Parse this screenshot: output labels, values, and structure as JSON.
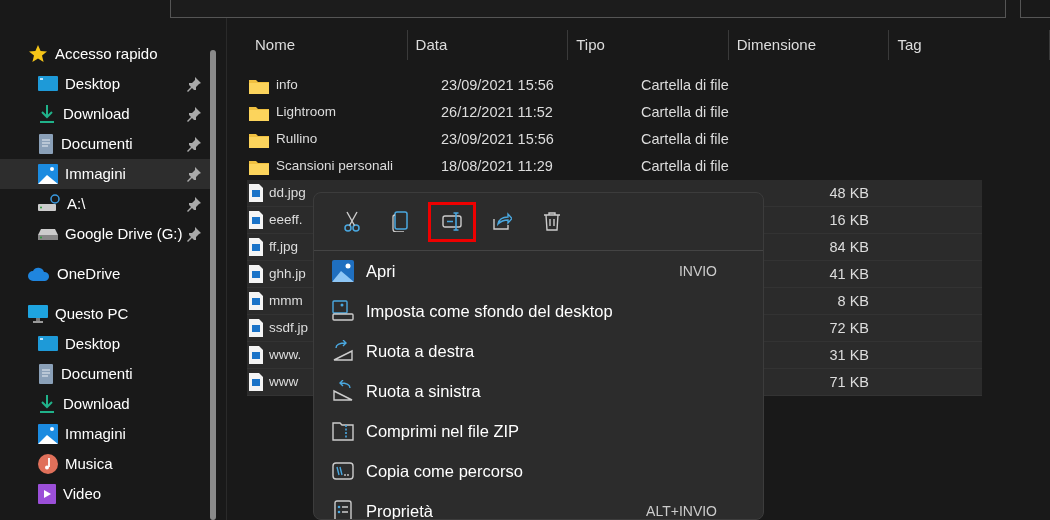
{
  "sidebar": {
    "items": [
      {
        "label": "Accesso rapido",
        "kind": "star",
        "children": [
          {
            "label": "Desktop",
            "kind": "desktop",
            "pinned": true,
            "selected": false
          },
          {
            "label": "Download",
            "kind": "download",
            "pinned": true,
            "selected": false
          },
          {
            "label": "Documenti",
            "kind": "document",
            "pinned": true,
            "selected": false
          },
          {
            "label": "Immagini",
            "kind": "pictures",
            "pinned": true,
            "selected": true
          },
          {
            "label": "A:\\",
            "kind": "netdrive",
            "pinned": true,
            "selected": false
          },
          {
            "label": "Google Drive (G:)",
            "kind": "drive",
            "pinned": true,
            "selected": false
          }
        ]
      },
      {
        "label": "OneDrive",
        "kind": "cloud"
      },
      {
        "label": "Questo PC",
        "kind": "pc",
        "children": [
          {
            "label": "Desktop",
            "kind": "desktop",
            "pinned": false,
            "selected": false
          },
          {
            "label": "Documenti",
            "kind": "document",
            "pinned": false,
            "selected": false
          },
          {
            "label": "Download",
            "kind": "download",
            "pinned": false,
            "selected": false
          },
          {
            "label": "Immagini",
            "kind": "pictures",
            "pinned": false,
            "selected": false
          },
          {
            "label": "Musica",
            "kind": "music",
            "pinned": false,
            "selected": false
          },
          {
            "label": "Video",
            "kind": "video",
            "pinned": false,
            "selected": false
          }
        ]
      }
    ]
  },
  "table": {
    "columns": [
      "Nome",
      "Data",
      "Tipo",
      "Dimensione",
      "Tag"
    ],
    "rows": [
      {
        "kind": "folder",
        "name": "info",
        "date": "23/09/2021 15:56",
        "type": "Cartella di file",
        "selected": false
      },
      {
        "kind": "folder",
        "name": "Lightroom",
        "date": "26/12/2021 11:52",
        "type": "Cartella di file",
        "selected": false
      },
      {
        "kind": "folder",
        "name": "Rullino",
        "date": "23/09/2021 15:56",
        "type": "Cartella di file",
        "selected": false
      },
      {
        "kind": "folder",
        "name": "Scansioni personali",
        "date": "18/08/2021 11:29",
        "type": "Cartella di file",
        "selected": false
      },
      {
        "kind": "image",
        "name": "dd.jpg",
        "size": "48 KB",
        "selected": true
      },
      {
        "kind": "image",
        "name": "eeeff.",
        "size": "16 KB",
        "selected": true
      },
      {
        "kind": "image",
        "name": "ff.jpg",
        "size": "84 KB",
        "selected": true
      },
      {
        "kind": "image",
        "name": "ghh.jp",
        "size": "41 KB",
        "selected": true
      },
      {
        "kind": "image",
        "name": "mmm",
        "size": "8 KB",
        "selected": true
      },
      {
        "kind": "image",
        "name": "ssdf.jp",
        "size": "72 KB",
        "selected": true
      },
      {
        "kind": "image",
        "name": "www.",
        "size": "31 KB",
        "selected": true
      },
      {
        "kind": "image",
        "name": "www",
        "size": "71 KB",
        "selected": true
      }
    ]
  },
  "context_menu": {
    "toolbar": [
      {
        "kind": "cut",
        "highlighted": false
      },
      {
        "kind": "copy",
        "highlighted": false
      },
      {
        "kind": "rename",
        "highlighted": true
      },
      {
        "kind": "share",
        "highlighted": false
      },
      {
        "kind": "delete",
        "highlighted": false
      }
    ],
    "items": [
      {
        "kind": "open",
        "label": "Apri",
        "shortcut": "INVIO"
      },
      {
        "kind": "wallpaper",
        "label": "Imposta come sfondo del desktop"
      },
      {
        "kind": "rotate-right",
        "label": "Ruota a destra"
      },
      {
        "kind": "rotate-left",
        "label": "Ruota a sinistra"
      },
      {
        "kind": "zip",
        "label": "Comprimi nel file ZIP"
      },
      {
        "kind": "path",
        "label": "Copia come percorso"
      },
      {
        "kind": "properties",
        "label": "Proprietà",
        "shortcut": "ALT+INVIO"
      }
    ]
  }
}
